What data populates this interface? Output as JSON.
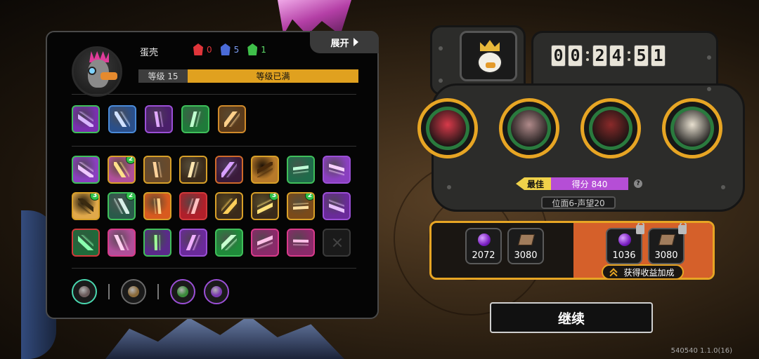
{
  "player": {
    "name": "蛋壳",
    "level_label": "等级 15",
    "level_status": "等级已满",
    "counters": [
      {
        "icon": "red-mask-icon",
        "value": "0",
        "color": "#e0353a"
      },
      {
        "icon": "blue-mask-icon",
        "value": "5",
        "color": "#4a6bd8"
      },
      {
        "icon": "green-mask-icon",
        "value": "1",
        "color": "#3fbf4a"
      }
    ]
  },
  "expand_label": "展开",
  "weapons": [
    {
      "icon": "claw-slash-icon",
      "border": "#3fbf5a",
      "bg": "#7a2fb0",
      "fg": "#d9b6ff"
    },
    {
      "icon": "shield-swirl-icon",
      "border": "#4a8ad8",
      "bg": "#2a4f8a",
      "fg": "#cfe0ff"
    },
    {
      "icon": "void-burst-icon",
      "border": "#9b4fd6",
      "bg": "#4a1f6a",
      "fg": "#e0a8ff"
    },
    {
      "icon": "tree-arrow-icon",
      "border": "#3fbf5a",
      "bg": "#1f7a3a",
      "fg": "#bfffcf"
    },
    {
      "icon": "bomb-belt-icon",
      "border": "#d08a2a",
      "bg": "#5a3a1a",
      "fg": "#ffd08a"
    }
  ],
  "skills": [
    {
      "icon": "rune-branch-icon",
      "border": "#3fbf5a",
      "bg": "#8a3fc0",
      "fg": "#f0c8ff",
      "badge": ""
    },
    {
      "icon": "flame-eye-icon",
      "border": "#d8a028",
      "bg": "#b04f9a",
      "fg": "#ffe08a",
      "badge": "2"
    },
    {
      "icon": "rune-network-icon",
      "border": "#d8a028",
      "bg": "#6a4a2a",
      "fg": "#ffd29a",
      "badge": ""
    },
    {
      "icon": "gear-sun-icon",
      "border": "#d8a028",
      "bg": "#3a2a1a",
      "fg": "#ffe6b0",
      "badge": ""
    },
    {
      "icon": "dark-hand-icon",
      "border": "#d06a2a",
      "bg": "#3a1a3a",
      "fg": "#d8a0ff",
      "badge": ""
    },
    {
      "icon": "wheat-claw-icon",
      "border": "#d8a028",
      "bg": "#b87a2a",
      "fg": "#4a2a0a",
      "badge": ""
    },
    {
      "icon": "grass-blade-icon",
      "border": "#3fbf5a",
      "bg": "#1f6a4a",
      "fg": "#c0ffd8",
      "badge": ""
    },
    {
      "icon": "ghost-mask-icon",
      "border": "#9b4fd6",
      "bg": "#8a3fc0",
      "fg": "#f8d0ff",
      "badge": ""
    },
    {
      "icon": "sunrise-icon",
      "border": "#d8a028",
      "bg": "#e0a84a",
      "fg": "#3a2a10",
      "badge": "3"
    },
    {
      "icon": "spike-trap-icon",
      "border": "#3fbf5a",
      "bg": "#2a5a4a",
      "fg": "#d8f0e8",
      "badge": "2"
    },
    {
      "icon": "fire-slash-icon",
      "border": "#d8a028",
      "bg": "#d85a1f",
      "fg": "#ffd08a",
      "badge": ""
    },
    {
      "icon": "red-shard-icon",
      "border": "#d03a3a",
      "bg": "#b01f2a",
      "fg": "#ffc0c0",
      "badge": ""
    },
    {
      "icon": "golden-ring-icon",
      "border": "#d8a028",
      "bg": "#3a2a1a",
      "fg": "#ffcf5a",
      "badge": ""
    },
    {
      "icon": "lightning-pillar-icon",
      "border": "#d8a028",
      "bg": "#3a2a1a",
      "fg": "#ffe27a",
      "badge": "3"
    },
    {
      "icon": "vortex-icon",
      "border": "#d8a028",
      "bg": "#7a4a1a",
      "fg": "#ffe0a0",
      "badge": "2"
    },
    {
      "icon": "purple-claw-icon",
      "border": "#9b4fd6",
      "bg": "#6a2a9a",
      "fg": "#e8c0ff",
      "badge": ""
    },
    {
      "icon": "heart-leaf-icon",
      "border": "#d03a3a",
      "bg": "#1f6a3a",
      "fg": "#8affb0",
      "badge": ""
    },
    {
      "icon": "spellbook-icon",
      "border": "#d83a8a",
      "bg": "#b04f9a",
      "fg": "#ffd0f0",
      "badge": ""
    },
    {
      "icon": "green-bolt-icon",
      "border": "#3fbf5a",
      "bg": "#5a2a8a",
      "fg": "#a0ff9a",
      "badge": ""
    },
    {
      "icon": "purple-flame-icon",
      "border": "#9b4fd6",
      "bg": "#6a2a9a",
      "fg": "#f0b0ff",
      "badge": ""
    },
    {
      "icon": "green-rush-icon",
      "border": "#3fbf5a",
      "bg": "#1f8a3a",
      "fg": "#c8ffd0",
      "badge": ""
    },
    {
      "icon": "pink-crown-icon",
      "border": "#d83a8a",
      "bg": "#8a2a6a",
      "fg": "#ffc0e8",
      "badge": ""
    },
    {
      "icon": "pink-crown-alt-icon",
      "border": "#d83a8a",
      "bg": "#8a2a6a",
      "fg": "#ffc0e8",
      "badge": ""
    },
    {
      "icon": "empty-slot-icon",
      "border": "#3a3a3a",
      "bg": "#1a1a1a",
      "fg": "#444444",
      "badge": "",
      "empty": true
    }
  ],
  "tools": [
    {
      "icon": "pale-orb-icon",
      "border": "#4ad8b0",
      "bg": "#6a5a5a"
    },
    {
      "icon": "bronze-orb-icon",
      "border": "#6a6a6a",
      "bg": "#8a6a3a"
    },
    {
      "icon": "green-orb-icon",
      "border": "#9b4fd6",
      "bg": "#3a8a3a"
    },
    {
      "icon": "purple-lotus-icon",
      "border": "#9b4fd6",
      "bg": "#7a3ab0"
    }
  ],
  "timer": {
    "digits": [
      "0",
      "0",
      "2",
      "4",
      "5",
      "1"
    ]
  },
  "portraits": [
    {
      "icon": "red-insect-mask-icon",
      "color": "#d83a4a"
    },
    {
      "icon": "armored-knight-icon",
      "color": "#b08a8a"
    },
    {
      "icon": "hooded-rider-icon",
      "color": "#8a2a2a"
    },
    {
      "icon": "glasses-guy-icon",
      "color": "#e8e0d0"
    }
  ],
  "best_label": "最佳",
  "score_label": "得分 840",
  "help_label": "?",
  "position_label": "位面6-声望20",
  "rewards": {
    "base": [
      {
        "icon": "purple-gem-icon",
        "value": "2072"
      },
      {
        "icon": "card-icon",
        "value": "3080"
      }
    ],
    "bonus": [
      {
        "icon": "purple-gem-icon",
        "value": "1036"
      },
      {
        "icon": "card-icon",
        "value": "3080"
      }
    ],
    "bonus_button": "获得收益加成"
  },
  "continue_label": "继续",
  "version": "540540 1.1.0(16)"
}
